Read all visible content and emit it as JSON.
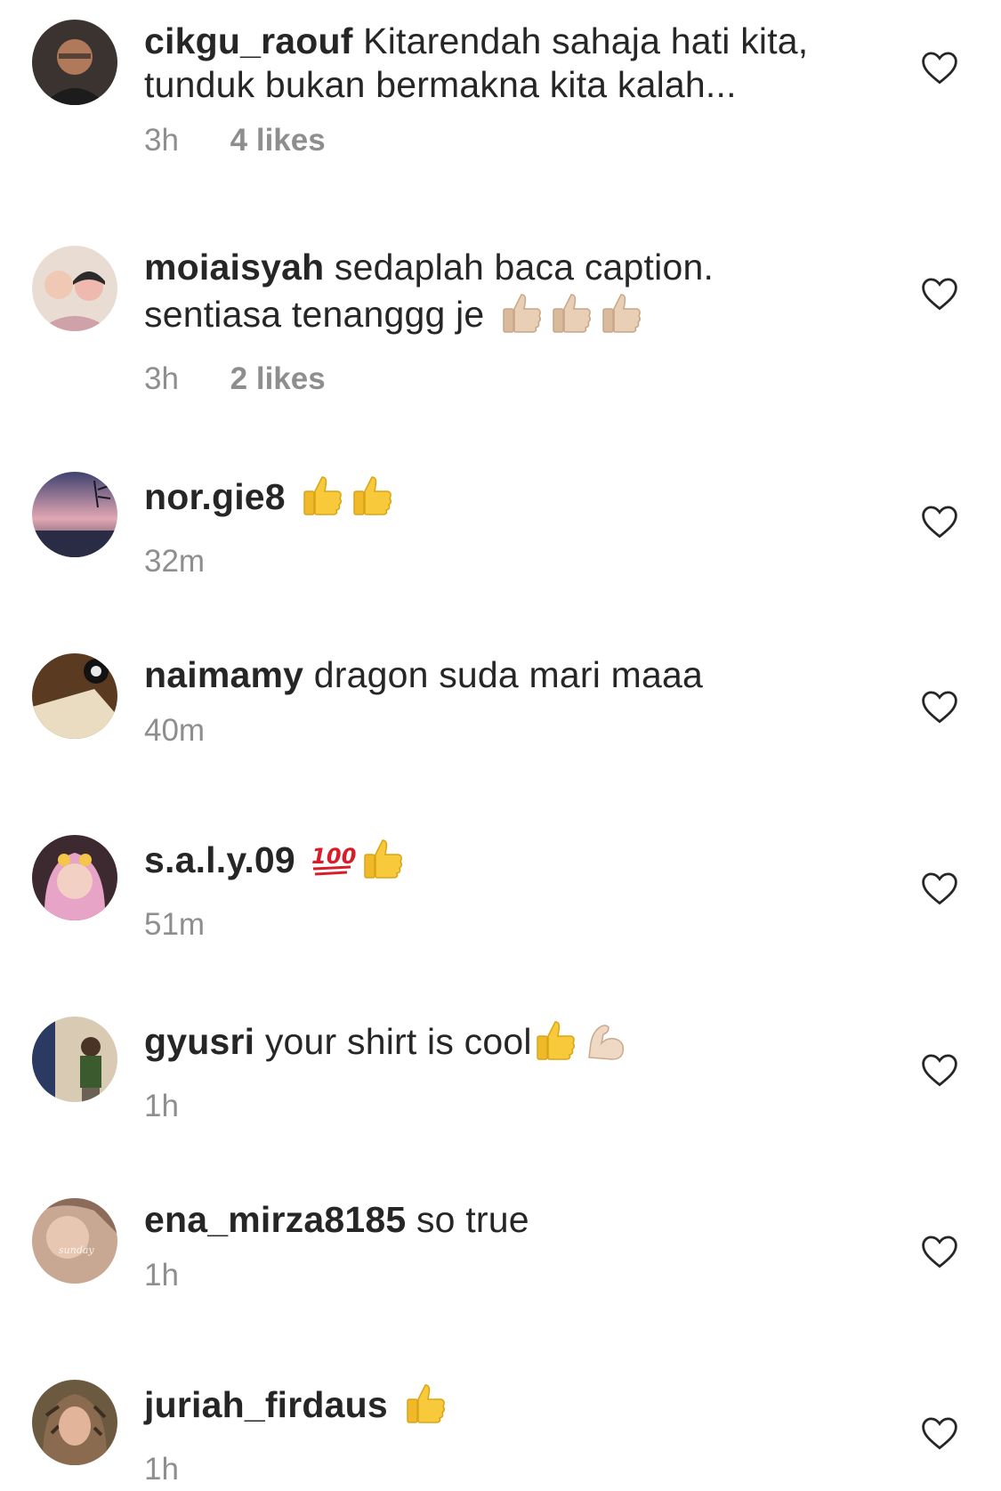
{
  "comments": [
    {
      "username": "cikgu_raouf",
      "text_line1": " Kitarendah sahaja hati kita,",
      "text_line2": "tunduk bukan bermakna kita kalah...",
      "time": "3h",
      "likes": "4 likes",
      "emojis": [],
      "avatar_colors": [
        "#3a3330",
        "#b07a5a",
        "#1c1c1c"
      ]
    },
    {
      "username": "moiaisyah",
      "text_line1": " sedaplah baca caption.",
      "text_line2": "sentiasa tenanggg je ",
      "time": "3h",
      "likes": "2 likes",
      "emojis": [
        "thumbs-up-light-tone",
        "thumbs-up-light-tone",
        "thumbs-up-light-tone"
      ],
      "avatar_colors": [
        "#e9ddd3",
        "#f0b9b0",
        "#2b2b2b"
      ]
    },
    {
      "username": "nor.gie8",
      "text_line1": " ",
      "text_line2": "",
      "time": "32m",
      "likes": "",
      "emojis": [
        "thumbs-up-yellow",
        "thumbs-up-yellow"
      ],
      "avatar_colors": [
        "#6a6f9a",
        "#e2a7b3",
        "#2a2c45"
      ]
    },
    {
      "username": "naimamy",
      "text_line1": " dragon suda mari maaa",
      "text_line2": "",
      "time": "40m",
      "likes": "",
      "emojis": [],
      "avatar_colors": [
        "#5b3a22",
        "#e9dcc0",
        "#121212"
      ]
    },
    {
      "username": "s.a.l.y.09",
      "text_line1": " ",
      "text_line2": "",
      "time": "51m",
      "likes": "",
      "emojis": [
        "hundred-points",
        "thumbs-up-yellow"
      ],
      "avatar_colors": [
        "#e8a4c7",
        "#f2d1c4",
        "#3d2a30"
      ]
    },
    {
      "username": "gyusri",
      "text_line1": " your shirt is cool",
      "text_line2": "",
      "time": "1h",
      "likes": "",
      "emojis": [
        "thumbs-up-yellow",
        "flexed-biceps-light-tone"
      ],
      "avatar_colors": [
        "#d9cbb3",
        "#3b5b2e",
        "#6b6155"
      ]
    },
    {
      "username": "ena_mirza8185",
      "text_line1": " so true",
      "text_line2": "",
      "time": "1h",
      "likes": "",
      "emojis": [],
      "avatar_colors": [
        "#c9a893",
        "#8b6b5a",
        "#efe3d8"
      ]
    },
    {
      "username": "juriah_firdaus",
      "text_line1": " ",
      "text_line2": "",
      "time": "1h",
      "likes": "",
      "emojis": [
        "thumbs-up-yellow"
      ],
      "avatar_colors": [
        "#8a6b4f",
        "#e2b59a",
        "#3c2f22"
      ]
    }
  ],
  "heart_icon": "heart-outline-icon",
  "colors": {
    "text": "#262626",
    "meta": "#8e8e8e",
    "heart": "#262626",
    "emoji_yellow": "#f7c93b",
    "emoji_light": "#e8cfb5",
    "hundred_red": "#d91c2a"
  }
}
